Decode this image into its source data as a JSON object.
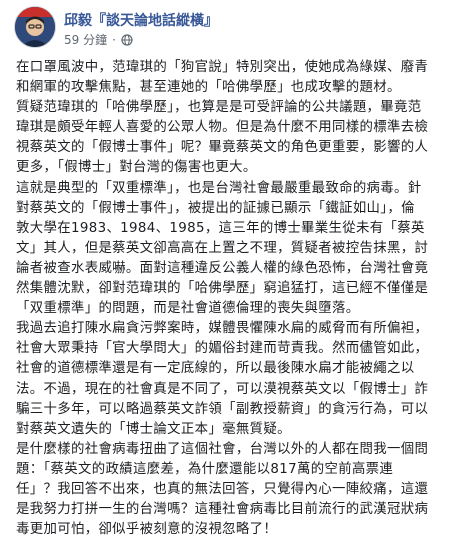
{
  "post": {
    "author": "邱毅『談天論地話縱橫』",
    "timestamp": "59 分鐘",
    "separator": "·",
    "privacy_icon": "globe-icon",
    "lines": [
      "在口罩風波中，范瑋琪的「狗官說」特別突出，使她成為綠媒、廢青",
      "和網軍的攻擊焦點，甚至連她的「哈佛學歷」也成攻擊的題材。",
      "質疑范瑋琪的「哈佛學歷」，也算是是可受評論的公共議題，畢竟范",
      "瑋琪是頗受年輕人喜愛的公眾人物。但是為什麼不用同樣的標準去檢",
      "視蔡英文的「假博士事件」呢？畢竟蔡英文的角色更重要，影響的人",
      "更多，「假博士」對台灣的傷害也更大。",
      "這就是典型的「双重標準」，也是台灣社會最嚴重最致命的病毒。針",
      "對蔡英文的「假博士事件」，被提出的証據已顯示「鐵証如山」，倫",
      "敦大學在1983、1984、1985，這三年的博士畢業生從未有「蔡英",
      "文」其人，但是蔡英文卻高高在上置之不理，質疑者被控告抹黑，討",
      "論者被查水表威嚇。面對這種違反公義人權的綠色恐怖，台灣社會竟",
      "然集體沈默，卻對范瑋琪的「哈佛學歷」窮追猛打，這已經不僅僅是",
      "「双重標準」的問題，而是社會道德倫理的喪失與墮落。",
      "我過去追打陳水扁貪污弊案時，媒體畏懼陳水扁的威脅而有所偏袒，",
      "社會大眾秉持「官大學問大」的媚俗封建而苛責我。然而儘管如此，",
      "社會的道德標準還是有一定底線的，所以最後陳水扁才能被繩之以",
      "法。不過，現在的社會真是不同了，可以漠視蔡英文以「假博士」詐",
      "騙三十多年，可以略過蔡英文詐領「副教授薪資」的貪污行為，可以",
      "對蔡英文遺失的「博士論文正本」毫無質疑。",
      "是什麼樣的社會病毒扭曲了這個社會，台灣以外的人都在問我一個問",
      "題：「蔡英文的政績這麼差，為什麼還能以817萬的空前高票連",
      "任」？我回答不出來，也真的無法回答，只覺得內心一陣絞痛，這還",
      "是我努力打拼一生的台灣嗎？這種社會病毒比目前流行的武漢冠狀病",
      "毒更加可怕，卻似乎被刻意的沒視忽略了！"
    ]
  }
}
